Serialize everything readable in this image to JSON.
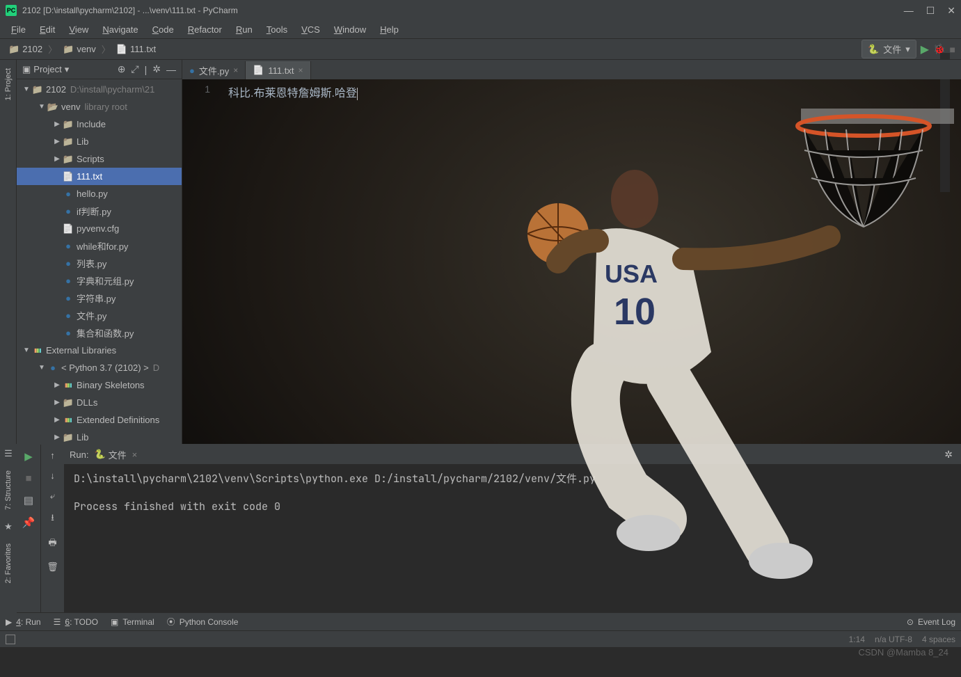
{
  "title": "2102 [D:\\install\\pycharm\\2102] - ...\\venv\\111.txt - PyCharm",
  "menu": [
    "File",
    "Edit",
    "View",
    "Navigate",
    "Code",
    "Refactor",
    "Run",
    "Tools",
    "VCS",
    "Window",
    "Help"
  ],
  "breadcrumb": [
    {
      "icon": "folder",
      "label": "2102"
    },
    {
      "icon": "folder",
      "label": "venv"
    },
    {
      "icon": "txt",
      "label": "111.txt"
    }
  ],
  "runconfig": {
    "label": "文件"
  },
  "sidebar": {
    "title": "Project",
    "tree": [
      {
        "d": 0,
        "arr": "▼",
        "ico": "folder",
        "label": "2102",
        "dim": "D:\\install\\pycharm\\21"
      },
      {
        "d": 1,
        "arr": "▼",
        "ico": "folderopen",
        "label": "venv",
        "dim": "library root"
      },
      {
        "d": 2,
        "arr": "▶",
        "ico": "folder",
        "label": "Include"
      },
      {
        "d": 2,
        "arr": "▶",
        "ico": "folder",
        "label": "Lib"
      },
      {
        "d": 2,
        "arr": "▶",
        "ico": "folder",
        "label": "Scripts"
      },
      {
        "d": 2,
        "arr": "",
        "ico": "txt",
        "label": "111.txt",
        "sel": true
      },
      {
        "d": 2,
        "arr": "",
        "ico": "py",
        "label": "hello.py"
      },
      {
        "d": 2,
        "arr": "",
        "ico": "py",
        "label": "if判断.py"
      },
      {
        "d": 2,
        "arr": "",
        "ico": "txt",
        "label": "pyvenv.cfg"
      },
      {
        "d": 2,
        "arr": "",
        "ico": "py",
        "label": "while和for.py"
      },
      {
        "d": 2,
        "arr": "",
        "ico": "py",
        "label": "列表.py"
      },
      {
        "d": 2,
        "arr": "",
        "ico": "py",
        "label": "字典和元组.py"
      },
      {
        "d": 2,
        "arr": "",
        "ico": "py",
        "label": "字符串.py"
      },
      {
        "d": 2,
        "arr": "",
        "ico": "py",
        "label": "文件.py"
      },
      {
        "d": 2,
        "arr": "",
        "ico": "py",
        "label": "集合和函数.py"
      },
      {
        "d": 0,
        "arr": "▼",
        "ico": "lib",
        "label": "External Libraries"
      },
      {
        "d": 1,
        "arr": "▼",
        "ico": "py",
        "label": "< Python 3.7 (2102) >",
        "dim": "D"
      },
      {
        "d": 2,
        "arr": "▶",
        "ico": "lib",
        "label": "Binary Skeletons"
      },
      {
        "d": 2,
        "arr": "▶",
        "ico": "folder",
        "label": "DLLs"
      },
      {
        "d": 2,
        "arr": "▶",
        "ico": "lib",
        "label": "Extended Definitions"
      },
      {
        "d": 2,
        "arr": "▶",
        "ico": "folder",
        "label": "Lib"
      }
    ]
  },
  "tabs": [
    {
      "ico": "py",
      "label": "文件.py"
    },
    {
      "ico": "txt",
      "label": "111.txt",
      "active": true
    }
  ],
  "editor": {
    "line_no": "1",
    "content": "科比.布莱恩特詹姆斯.哈登"
  },
  "run_panel": {
    "header_label": "Run:",
    "config_name": "文件",
    "console": "D:\\install\\pycharm\\2102\\venv\\Scripts\\python.exe D:/install/pycharm/2102/venv/文件.py\n\nProcess finished with exit code 0"
  },
  "left_labels": {
    "project": "1: Project",
    "structure": "7: Structure",
    "favorites": "2: Favorites"
  },
  "bottom": [
    {
      "ico": "▶",
      "label": "4: Run",
      "u": "4"
    },
    {
      "ico": "☰",
      "label": "6: TODO",
      "u": "6"
    },
    {
      "ico": "▣",
      "label": "Terminal"
    },
    {
      "ico": "⦿",
      "label": "Python Console"
    }
  ],
  "bottom_right": {
    "ico": "⊙",
    "label": "Event Log"
  },
  "status": {
    "pos": "1:14",
    "enc": "n/a  UTF-8",
    "indent": "4 spaces"
  },
  "watermark": "CSDN @Mamba 8_24"
}
